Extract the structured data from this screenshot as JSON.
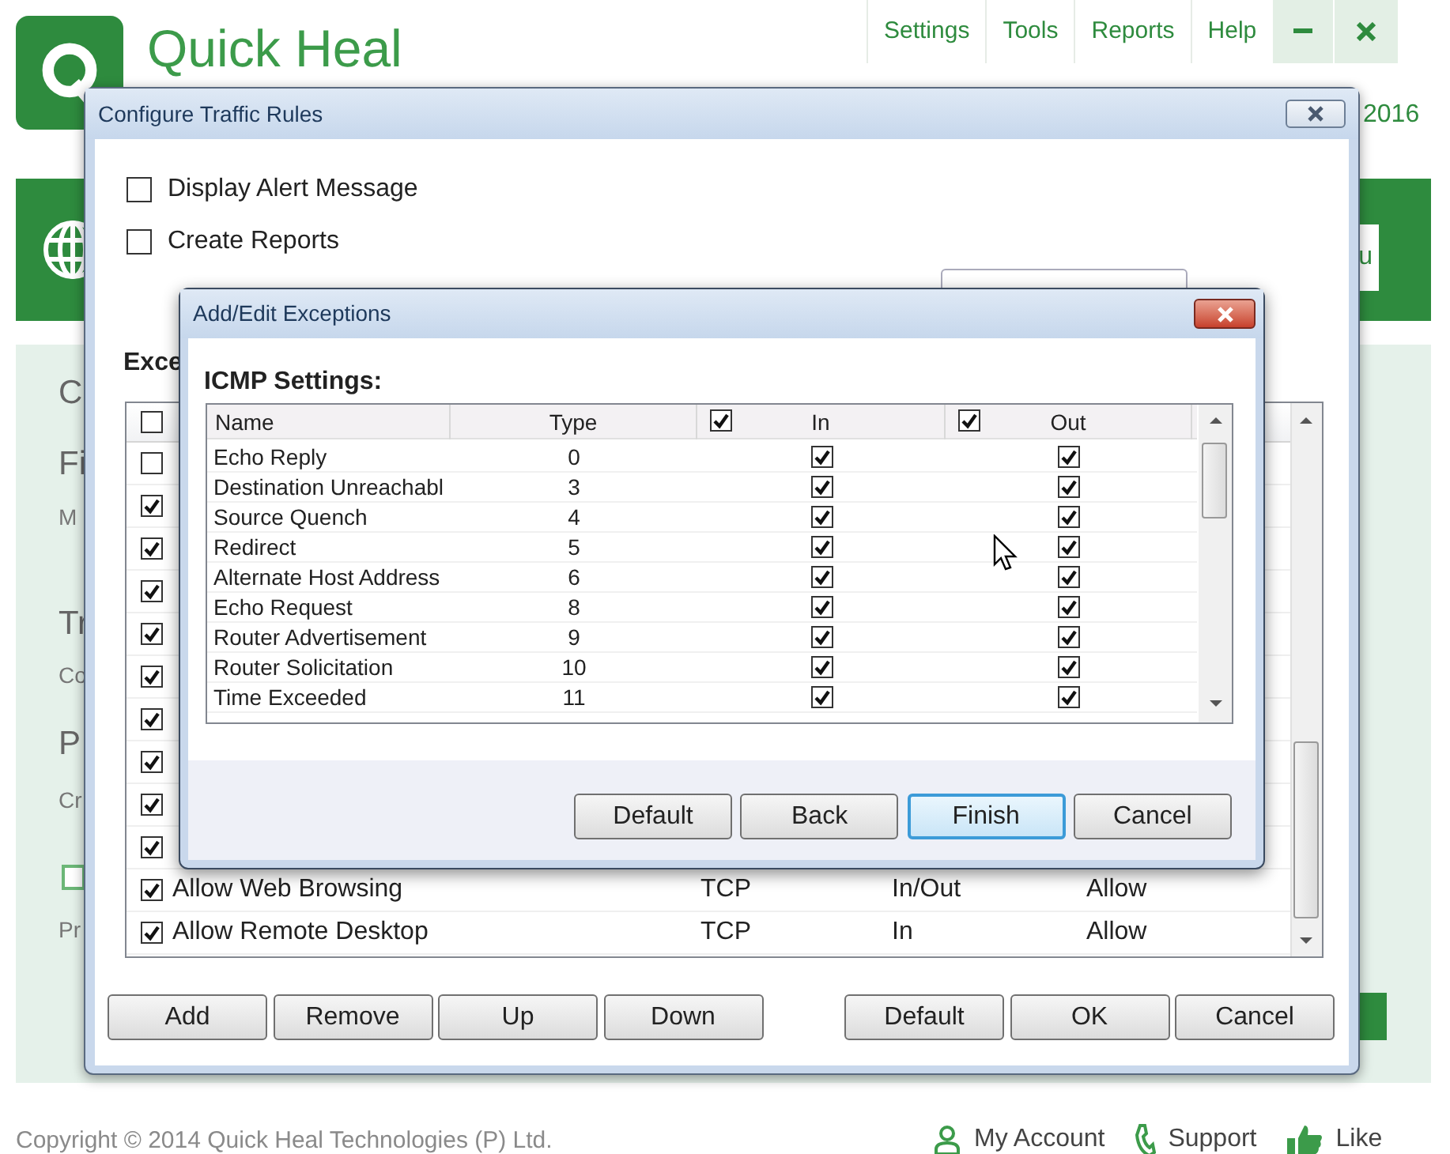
{
  "app": {
    "title": "Quick Heal",
    "menu": [
      {
        "label": "Settings"
      },
      {
        "label": "Tools"
      },
      {
        "label": "Reports"
      },
      {
        "label": "Help"
      }
    ],
    "year": "2016",
    "banner_button": "u",
    "side_texts": [
      {
        "text": "C",
        "kind": "heading"
      },
      {
        "text": "Fi",
        "kind": "heading"
      },
      {
        "text": "M",
        "kind": "small"
      },
      {
        "text": "Tr",
        "kind": "heading"
      },
      {
        "text": "Co",
        "kind": "small"
      },
      {
        "text": "P",
        "kind": "heading"
      },
      {
        "text": "Cr",
        "kind": "small"
      },
      {
        "text": "Pr",
        "kind": "small"
      }
    ],
    "side_checkbox": {
      "checked": false
    },
    "footer": {
      "copyright": "Copyright © 2014 Quick Heal Technologies (P) Ltd.",
      "links": [
        {
          "label": "My Account",
          "kind": "account"
        },
        {
          "label": "Support",
          "kind": "support"
        },
        {
          "label": "Like",
          "kind": "like"
        }
      ]
    }
  },
  "traffic_dialog": {
    "title": "Configure Traffic Rules",
    "options": [
      {
        "label": "Display Alert Message",
        "checked": false
      },
      {
        "label": "Create Reports",
        "checked": false
      }
    ],
    "section_label": "Exce",
    "list": {
      "header_checked": false,
      "rows": [
        {
          "checked": false
        },
        {
          "checked": true
        },
        {
          "checked": true
        },
        {
          "checked": true
        },
        {
          "checked": true
        },
        {
          "checked": true
        },
        {
          "checked": true
        },
        {
          "checked": true
        },
        {
          "checked": true
        },
        {
          "checked": true
        },
        {
          "checked": true,
          "name": "Allow Web Browsing",
          "protocol": "TCP",
          "direction": "In/Out",
          "action": "Allow"
        },
        {
          "checked": true,
          "name": "Allow Remote Desktop",
          "protocol": "TCP",
          "direction": "In",
          "action": "Allow"
        }
      ]
    },
    "buttons_left": [
      "Add",
      "Remove",
      "Up",
      "Down"
    ],
    "buttons_right": [
      "Default",
      "OK",
      "Cancel"
    ]
  },
  "exceptions_dialog": {
    "title": "Add/Edit Exceptions",
    "section_label": "ICMP Settings:",
    "columns": [
      {
        "label": "Name"
      },
      {
        "label": "Type"
      },
      {
        "label": "In",
        "checked": true
      },
      {
        "label": "Out",
        "checked": true
      }
    ],
    "rows": [
      {
        "name": "Echo Reply",
        "type": "0",
        "in": true,
        "out": true
      },
      {
        "name": "Destination Unreachabl",
        "type": "3",
        "in": true,
        "out": true
      },
      {
        "name": "Source Quench",
        "type": "4",
        "in": true,
        "out": true
      },
      {
        "name": "Redirect",
        "type": "5",
        "in": true,
        "out": true
      },
      {
        "name": "Alternate Host Address",
        "type": "6",
        "in": true,
        "out": true
      },
      {
        "name": "Echo Request",
        "type": "8",
        "in": true,
        "out": true
      },
      {
        "name": "Router Advertisement",
        "type": "9",
        "in": true,
        "out": true
      },
      {
        "name": "Router Solicitation",
        "type": "10",
        "in": true,
        "out": true
      },
      {
        "name": "Time Exceeded",
        "type": "11",
        "in": true,
        "out": true
      }
    ],
    "buttons": [
      {
        "label": "Default",
        "focused": false
      },
      {
        "label": "Back",
        "focused": false
      },
      {
        "label": "Finish",
        "focused": true
      },
      {
        "label": "Cancel",
        "focused": false
      }
    ]
  }
}
